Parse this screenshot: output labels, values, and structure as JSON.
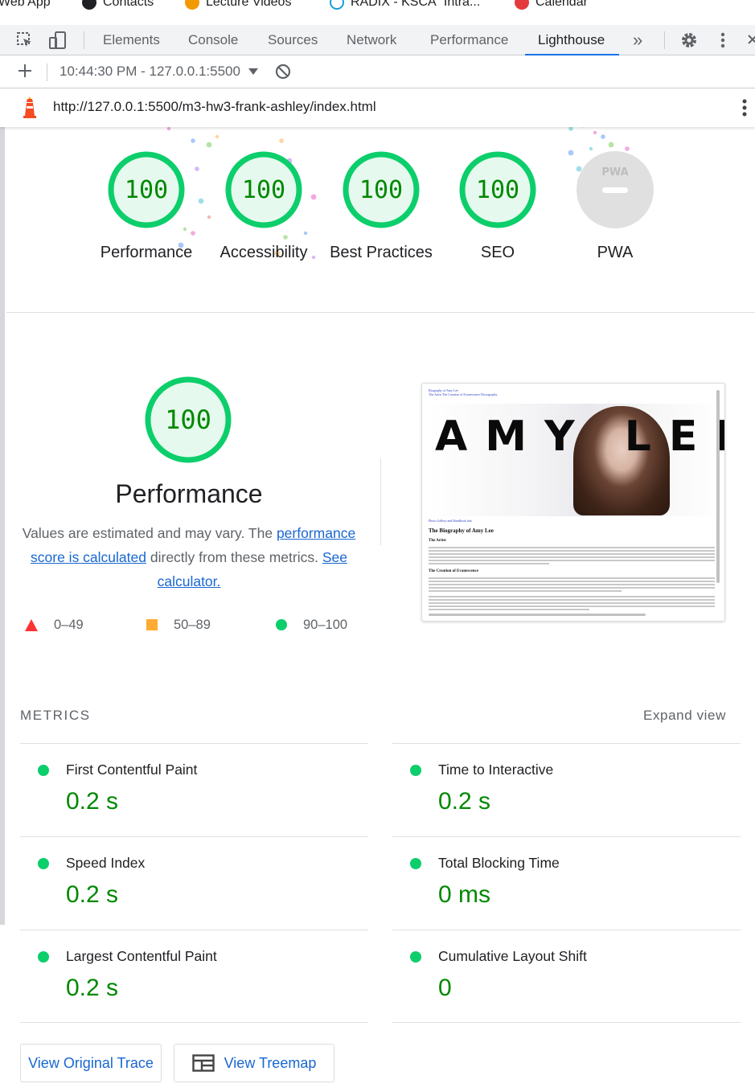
{
  "bookmarks": [
    {
      "label": "Web App",
      "icon": "web-app-icon"
    },
    {
      "label": "Contacts",
      "icon": "contacts-icon"
    },
    {
      "label": "Lecture Videos",
      "icon": "lecture-videos-icon"
    },
    {
      "label": "RADIX - KSCA \"Intra...",
      "icon": "radix-icon"
    },
    {
      "label": "Calendar",
      "icon": "calendar-icon"
    }
  ],
  "devtools": {
    "tabs": [
      "Elements",
      "Console",
      "Sources",
      "Network",
      "Performance",
      "Lighthouse"
    ],
    "active_tab": "Lighthouse",
    "more_tabs": "»",
    "report_selector": "10:44:30 PM - 127.0.0.1:5500",
    "url": "http://127.0.0.1:5500/m3-hw3-frank-ashley/index.html"
  },
  "categories": [
    {
      "label": "Performance",
      "score": "100"
    },
    {
      "label": "Accessibility",
      "score": "100"
    },
    {
      "label": "Best Practices",
      "score": "100"
    },
    {
      "label": "SEO",
      "score": "100"
    },
    {
      "label": "PWA",
      "score": ""
    }
  ],
  "performance": {
    "score": "100",
    "title": "Performance",
    "desc_prefix": "Values are estimated and may vary. The",
    "desc_link": "performance score is calculated",
    "desc_middle": "directly from these metrics.",
    "desc_link2": "See calculator."
  },
  "legend": [
    {
      "range": "0–49",
      "color": "#ff3333"
    },
    {
      "range": "50–89",
      "color": "#ffaa33"
    },
    {
      "range": "90–100",
      "color": "#0cce6b"
    }
  ],
  "metrics": {
    "heading": "METRICS",
    "expand_label": "Expand view",
    "items": [
      {
        "title": "First Contentful Paint",
        "value": "0.2 s"
      },
      {
        "title": "Time to Interactive",
        "value": "0.2 s"
      },
      {
        "title": "Speed Index",
        "value": "0.2 s"
      },
      {
        "title": "Total Blocking Time",
        "value": "0 ms"
      },
      {
        "title": "Largest Contentful Paint",
        "value": "0.2 s"
      },
      {
        "title": "Cumulative Layout Shift",
        "value": "0"
      }
    ]
  },
  "buttons": {
    "trace": "View Original Trace",
    "treemap": "View Treemap"
  },
  "thumbnail": {
    "banner": "AMY LEE",
    "nav_link1": "Biography of Amy Lee",
    "nav_link2": "The Artist The Creation of Evanescence Discography",
    "caption_link": "Photo Gallery and Handbook info",
    "heading": "The Biography of Amy Lee",
    "sub1": "The Artist",
    "sub2": "The Creation of Evanescence"
  },
  "colors": {
    "pass": "#0cce6b",
    "pass_text": "#008800",
    "link": "#1967d2",
    "tab_indicator": "#1a73e8"
  }
}
